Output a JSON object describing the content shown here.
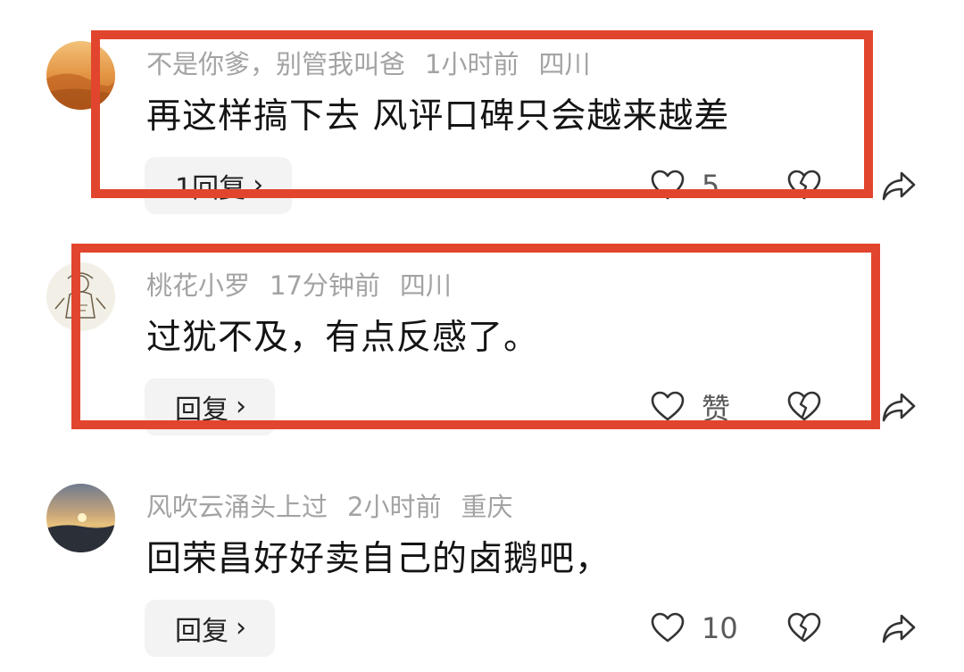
{
  "comments": [
    {
      "username": "不是你爹，别管我叫爸",
      "time": "1小时前",
      "location": "四川",
      "text": "再这样搞下去 风评口碑只会越来越差",
      "reply_label": "1回复",
      "likes": "5"
    },
    {
      "username": "桃花小罗",
      "time": "17分钟前",
      "location": "四川",
      "text": "过犹不及，有点反感了。",
      "reply_label": "回复",
      "likes": "赞"
    },
    {
      "username": "风吹云涌头上过",
      "time": "2小时前",
      "location": "重庆",
      "text": "回荣昌好好卖自己的卤鹅吧，",
      "reply_label": "回复",
      "likes": "10"
    }
  ],
  "colors": {
    "highlight": "#e2452d",
    "meta_text": "#a3a3a3",
    "body_text": "#141414",
    "reply_bg": "#f3f3f3"
  },
  "icons": [
    "heart-icon",
    "broken-heart-icon",
    "share-arrow-icon",
    "chevron-right-icon"
  ]
}
